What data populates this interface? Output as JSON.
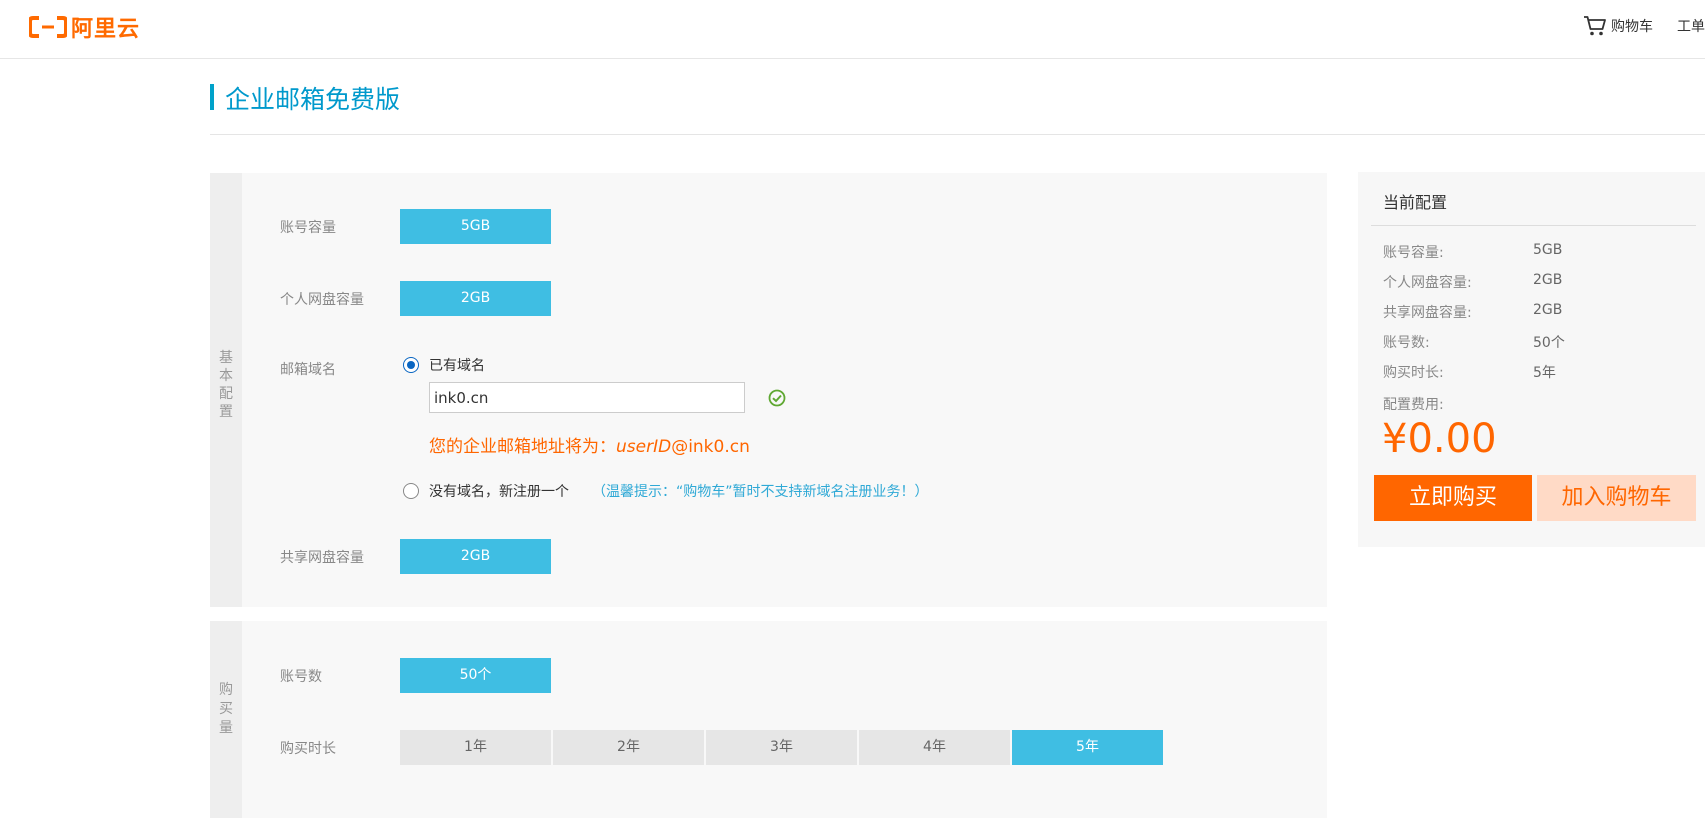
{
  "header": {
    "logo_text": "阿里云",
    "cart_label": "购物车",
    "ticket_label": "工单"
  },
  "page_title": "企业邮箱免费版",
  "basic_section": {
    "label_chars": [
      "基",
      "本",
      "配",
      "置"
    ],
    "account_capacity": {
      "label": "账号容量",
      "value": "5GB"
    },
    "personal_disk": {
      "label": "个人网盘容量",
      "value": "2GB"
    },
    "domain": {
      "label": "邮箱域名",
      "option_existing": "已有域名",
      "input_value": "ink0.cn",
      "address_prefix": "您的企业邮箱地址将为：",
      "address_user": "userID",
      "address_suffix": "@ink0.cn",
      "option_new": "没有域名，新注册一个",
      "tip": "（温馨提示：“购物车”暂时不支持新域名注册业务！）"
    },
    "shared_disk": {
      "label": "共享网盘容量",
      "value": "2GB"
    }
  },
  "purchase_section": {
    "label_chars": [
      "购",
      "买",
      "量"
    ],
    "accounts": {
      "label": "账号数",
      "value": "50个"
    },
    "duration": {
      "label": "购买时长",
      "options": [
        "1年",
        "2年",
        "3年",
        "4年",
        "5年"
      ],
      "selected": "5年"
    }
  },
  "config_panel": {
    "title": "当前配置",
    "rows": [
      {
        "label": "账号容量:",
        "value": "5GB"
      },
      {
        "label": "个人网盘容量:",
        "value": "2GB"
      },
      {
        "label": "共享网盘容量:",
        "value": "2GB"
      },
      {
        "label": "账号数:",
        "value": "50个"
      },
      {
        "label": "购买时长:",
        "value": "5年"
      }
    ],
    "fee_label": "配置费用:",
    "price": "¥0.00",
    "buy_now": "立即购买",
    "add_to_cart": "加入购物车"
  },
  "colors": {
    "brand_orange": "#ff6a00",
    "option_blue": "#3fbee3",
    "title_blue": "#0099cc",
    "price_orange": "#ff6600"
  },
  "icons": {
    "logo": "aliyun-logo-icon",
    "cart": "cart-icon",
    "check": "check-circle-icon"
  }
}
